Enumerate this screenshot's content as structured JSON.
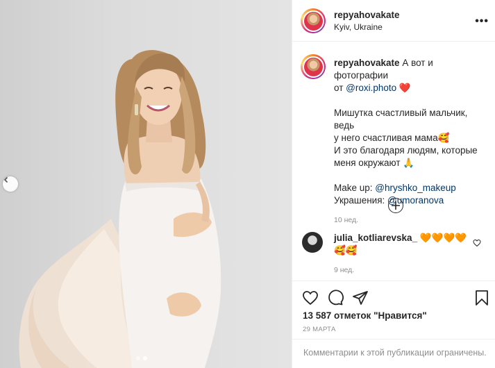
{
  "post": {
    "username": "repyahovakate",
    "location": "Kyiv, Ukraine",
    "more_icon": "more-dots-icon"
  },
  "caption": {
    "username": "repyahovakate",
    "line1_text": " А вот и фотографии",
    "line2_prefix": "от ",
    "line2_mention": "@roxi.photo",
    "line2_emoji": "❤️",
    "para2_line1": "Мишутка счастливый мальчик, ведь",
    "para2_line2": "у него счастливая мама",
    "para2_line2_emoji": "🥰",
    "para2_line3": "И это благодаря людям, которые",
    "para2_line4": "меня окружают ",
    "para2_line4_emoji": "🙏",
    "makeup_label": "Make up: ",
    "makeup_mention": "@hryshko_makeup",
    "jewelry_label": "Украшения: ",
    "jewelry_mention": "@umoranova",
    "time": "10 нед."
  },
  "comment": {
    "username": "julia_kotliarevska_",
    "text": " 🧡🧡🧡🧡",
    "text_line2": "🥰🥰",
    "time": "9 нед."
  },
  "actions": {
    "likes": "13 587 отметок \"Нравится\"",
    "date": "29 МАРТА",
    "comments_closed": "Комментарии к этой публикации ограничены."
  },
  "carousel": {
    "slide_count": 2,
    "active_index": 1
  },
  "colors": {
    "link": "#00376b",
    "muted": "#8e8e8e",
    "text": "#262626"
  }
}
